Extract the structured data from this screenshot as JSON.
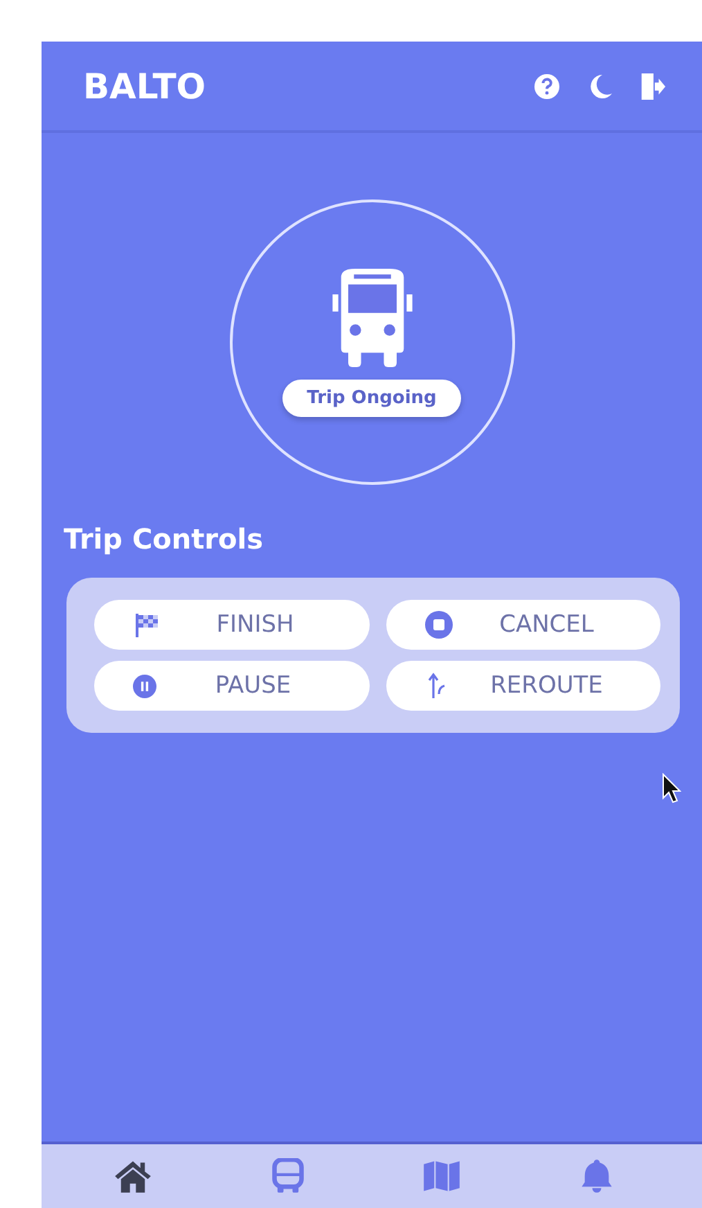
{
  "app_title": "BALTO",
  "header_actions": [
    {
      "kind": "help"
    },
    {
      "kind": "theme"
    },
    {
      "kind": "logout"
    }
  ],
  "status": {
    "label": "Trip Ongoing"
  },
  "controls": {
    "title": "Trip Controls",
    "buttons": [
      {
        "kind": "finish",
        "label": "FINISH"
      },
      {
        "kind": "cancel",
        "label": "CANCEL"
      },
      {
        "kind": "pause",
        "label": "PAUSE"
      },
      {
        "kind": "reroute",
        "label": "REROUTE"
      }
    ]
  },
  "nav": [
    {
      "kind": "home",
      "selected": true
    },
    {
      "kind": "bus",
      "selected": false
    },
    {
      "kind": "map",
      "selected": false
    },
    {
      "kind": "alerts",
      "selected": false
    }
  ]
}
